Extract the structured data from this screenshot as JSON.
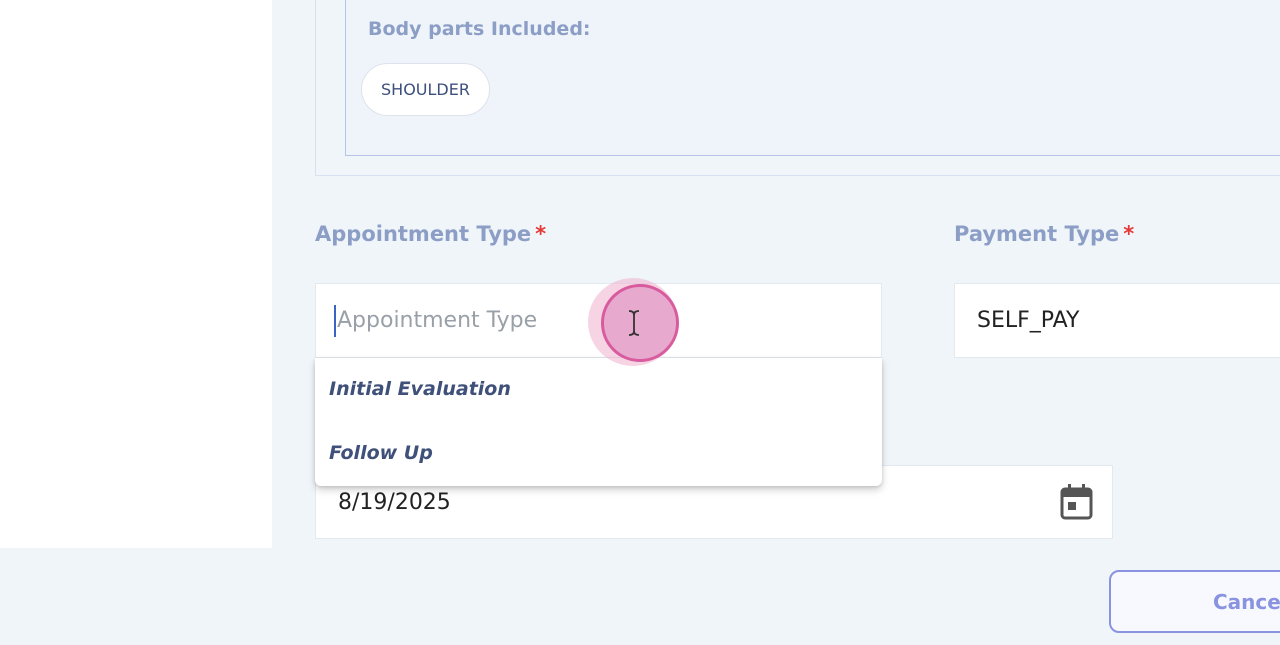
{
  "body_parts": {
    "label": "Body parts Included:",
    "chips": [
      "SHOULDER"
    ]
  },
  "appointment_type": {
    "label": "Appointment Type",
    "required_mark": "*",
    "placeholder": "Appointment Type",
    "value": "",
    "options": [
      "Initial Evaluation",
      "Follow Up"
    ]
  },
  "payment_type": {
    "label": "Payment Type",
    "required_mark": "*",
    "value": "SELF_PAY"
  },
  "date_field": {
    "value": "8/19/2025",
    "icon": "calendar-icon"
  },
  "actions": {
    "cancel_label": "Cance"
  },
  "colors": {
    "label": "#8c9ec6",
    "required": "#e53935",
    "button_border": "#8a93e0",
    "option_text": "#3f5079",
    "cursor_highlight": "#e8a9cf"
  }
}
